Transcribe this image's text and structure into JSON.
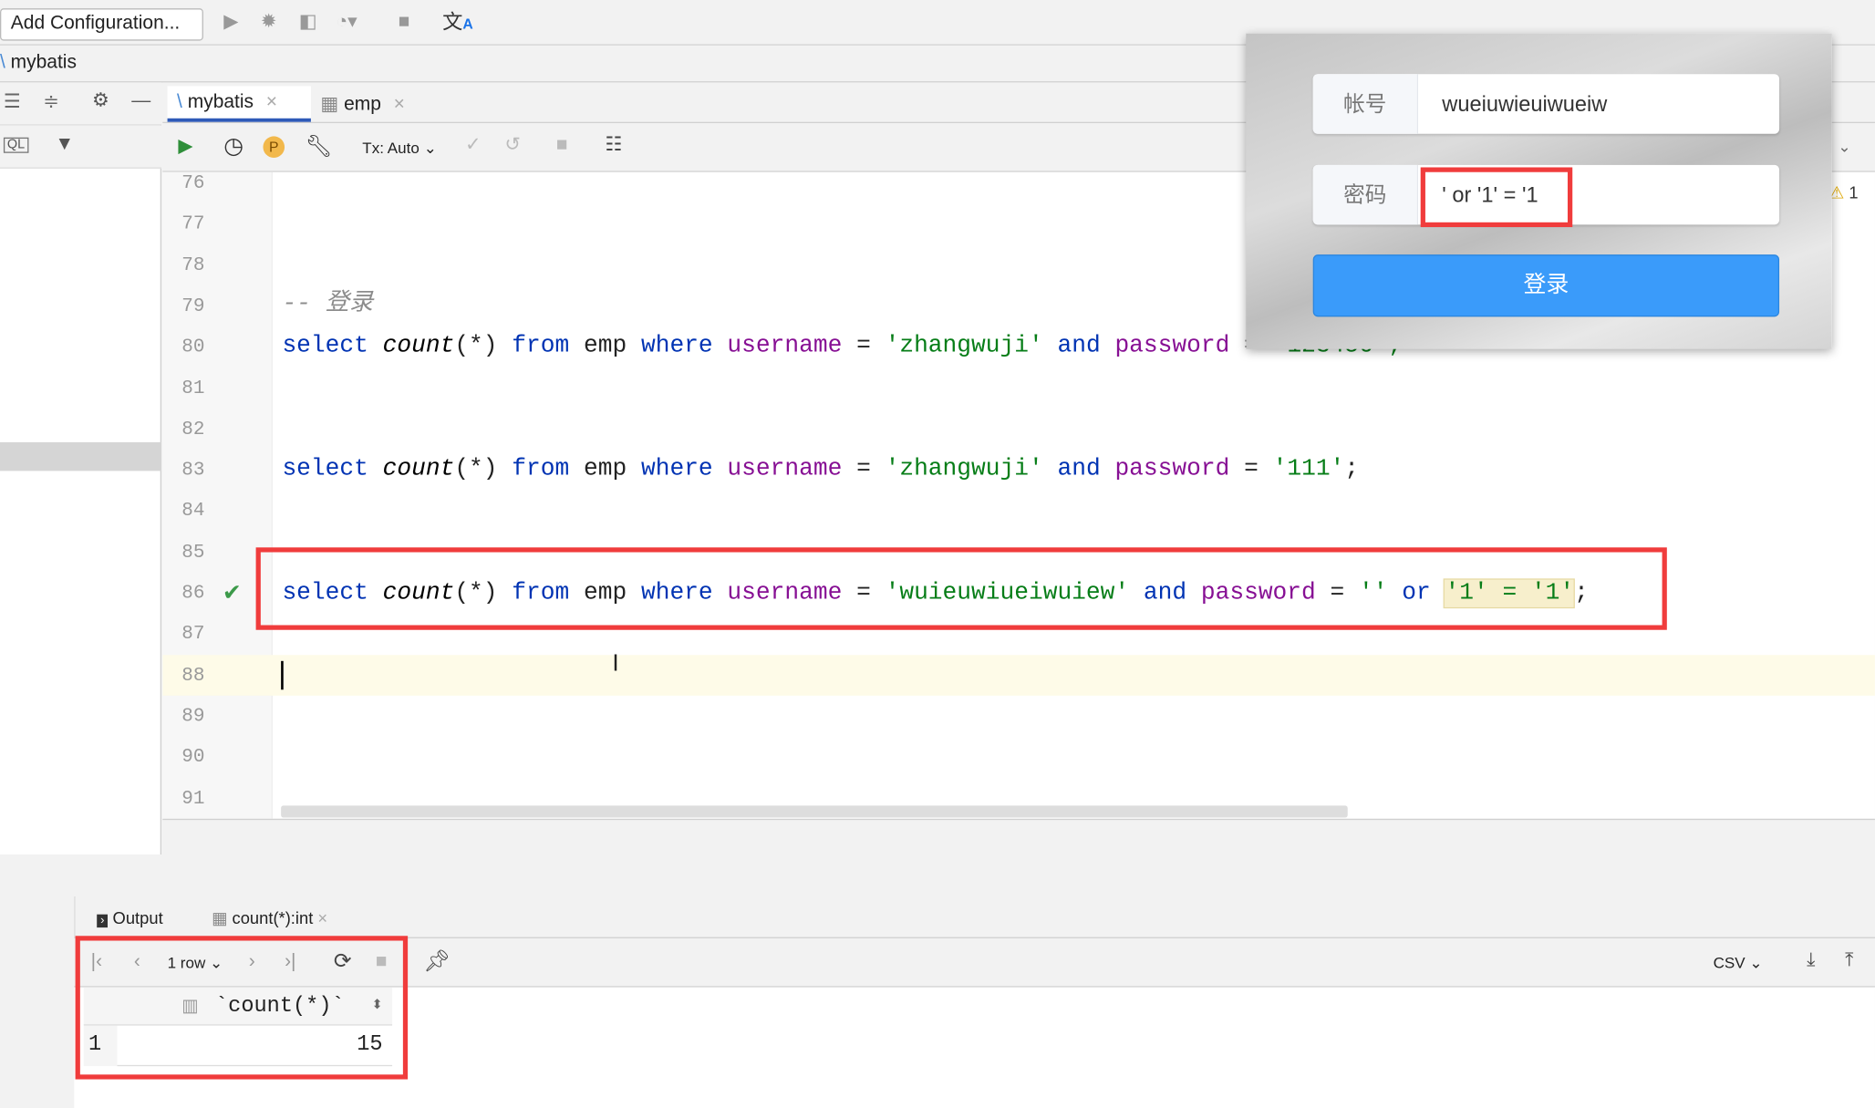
{
  "toolbar": {
    "add_config": "Add Configuration..."
  },
  "project": {
    "name": "mybatis"
  },
  "tabs": [
    {
      "label": "mybatis",
      "active": true
    },
    {
      "label": "emp",
      "active": false
    }
  ],
  "console_toolbar": {
    "tx_mode": "Tx: Auto"
  },
  "editor": {
    "line_numbers": [
      "76",
      "77",
      "78",
      "79",
      "80",
      "81",
      "82",
      "83",
      "84",
      "85",
      "86",
      "87",
      "88",
      "89",
      "90",
      "91"
    ],
    "comment": "-- 登录",
    "line80": {
      "kw1": "select",
      "fn": "count",
      "args": "(*)",
      "kw2": "from",
      "tbl": "emp",
      "kw3": "where",
      "col1": "username",
      "eq": "=",
      "s1": "'zhangwuji'",
      "kw4": "and",
      "col2": "password",
      "s2": "'123456';"
    },
    "line83": {
      "kw1": "select",
      "fn": "count",
      "args": "(*)",
      "kw2": "from",
      "tbl": "emp",
      "kw3": "where",
      "col1": "username",
      "eq": "=",
      "s1": "'zhangwuji'",
      "kw4": "and",
      "col2": "password",
      "s2": "'111'",
      "end": ";"
    },
    "line86": {
      "kw1": "select",
      "fn": "count",
      "args": "(*)",
      "kw2": "from",
      "tbl": "emp",
      "kw3": "where",
      "col1": "username",
      "eq": "=",
      "s1": "'wuieuwiueiwuiew'",
      "kw4": "and",
      "col2": "password",
      "s2": "''",
      "kw5": "or",
      "s3": "'1' = '1'",
      "end": ";"
    },
    "warning_count": "1"
  },
  "login_form": {
    "account_label": "帐号",
    "account_value": "wueiuwieuiwueiw",
    "password_label": "密码",
    "password_value": "' or '1' = '1",
    "submit": "登录",
    "button_color": "#3a9bfa"
  },
  "results": {
    "tabs": [
      {
        "label": "Output"
      },
      {
        "label": "count(*):int"
      }
    ],
    "rows_label": "1 row",
    "export": "CSV",
    "column": "`count(*)`",
    "rows": [
      {
        "index": "1",
        "value": "15"
      }
    ]
  },
  "colors": {
    "highlight_box": "#f03c3c",
    "keyword": "#0033b3",
    "identifier": "#871094",
    "string": "#067d17"
  }
}
